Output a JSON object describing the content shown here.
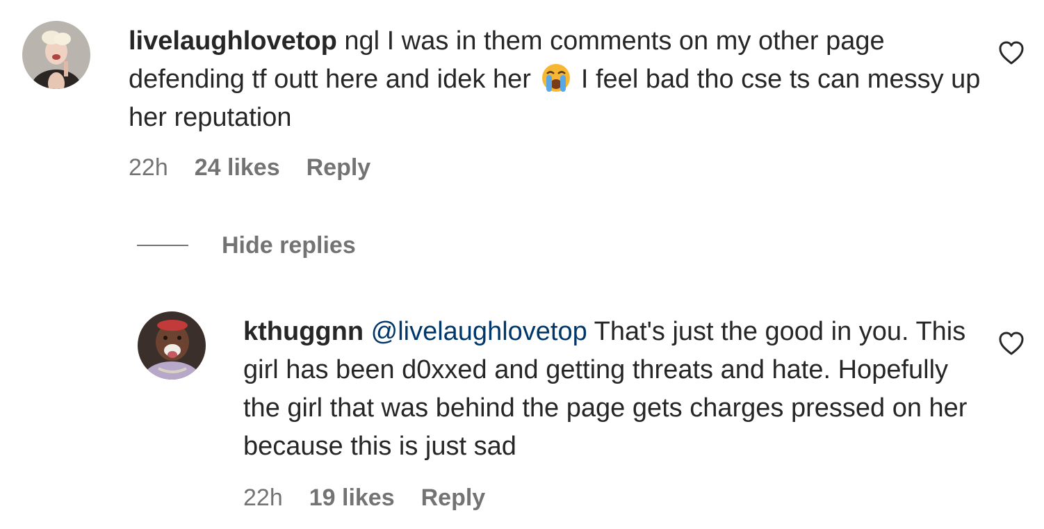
{
  "comment": {
    "avatar_icon": "avatar-woman-photo",
    "username": "livelaughlovetop",
    "text_before_emoji": "ngl I was in them comments on my other page defending tf outt here and idek her",
    "emoji": "loudly-crying-face-emoji",
    "text_after_emoji": "I feel bad tho cse ts can messy up her reputation",
    "time": "22h",
    "likes": "24 likes",
    "reply_label": "Reply",
    "like_icon": "heart-icon"
  },
  "replies_toggle": {
    "label": "Hide replies"
  },
  "reply": {
    "avatar_icon": "avatar-man-photo",
    "username": "kthuggnn",
    "mention": "@livelaughlovetop",
    "text": "That's just the good in you. This girl has been d0xxed and getting threats and hate. Hopefully the girl that was behind the page gets charges pressed on her because this is just sad",
    "time": "22h",
    "likes": "19 likes",
    "reply_label": "Reply",
    "like_icon": "heart-icon"
  },
  "colors": {
    "text_primary": "#262626",
    "text_secondary": "#737373",
    "mention": "#00376b"
  }
}
